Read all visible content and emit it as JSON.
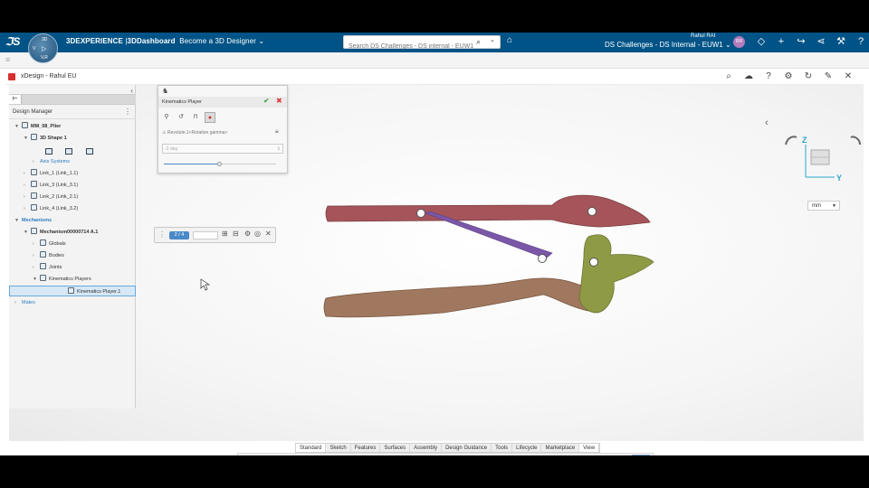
{
  "topbar": {
    "brand_prefix": "3DEXPERIENCE",
    "brand_sep": "|",
    "app": "3DDashboard",
    "dashboard": "Become a 3D Designer",
    "search_placeholder": "Search DS Challenges - DS internal - EUW1",
    "user_name": "Rahul  RAI",
    "tenant": "DS Challenges - DS Internal - EUW1",
    "avatar": "RR",
    "compass": {
      "n": "3D",
      "w": "V",
      "e": "▷",
      "s": "V,R"
    }
  },
  "app": {
    "title": "xDesign - Rahul EU"
  },
  "design_manager": {
    "title": "Design Manager",
    "tree": [
      {
        "label": "MM_08_Plier",
        "level": 0,
        "bold": true,
        "expanded": true
      },
      {
        "label": "3D Shape 1",
        "level": 1,
        "bold": true,
        "expanded": true
      },
      {
        "label": "Axis Systems",
        "level": 2,
        "blue": true,
        "expanded": false
      },
      {
        "label": "Link_1 (Link_1.1)",
        "level": 1,
        "expanded": false
      },
      {
        "label": "Link_3 (Link_3.1)",
        "level": 1,
        "expanded": false
      },
      {
        "label": "Link_2 (Link_2.1)",
        "level": 1,
        "expanded": false
      },
      {
        "label": "Link_4 (Link_3.2)",
        "level": 1,
        "expanded": false
      },
      {
        "label": "Mechanisms",
        "level": 0,
        "blue": true,
        "bold": true,
        "expanded": true
      },
      {
        "label": "Mechanism00000714 A.1",
        "level": 1,
        "bold": true,
        "expanded": true
      },
      {
        "label": "Globals",
        "level": 2,
        "expanded": false
      },
      {
        "label": "Bodies",
        "level": 2,
        "expanded": false
      },
      {
        "label": "Joints",
        "level": 2,
        "expanded": false
      },
      {
        "label": "Kinematics Players",
        "level": 2,
        "expanded": true
      },
      {
        "label": "Kinematics Player.1",
        "level": 3,
        "selected": true
      },
      {
        "label": "Mates",
        "level": 0,
        "blue": true,
        "expanded": false
      }
    ]
  },
  "kinematics_player": {
    "title": "Kinematics Player",
    "joint": "Revolute.1<Rotation gamma>",
    "value": "-3 deg",
    "slider_fraction": 0.5
  },
  "player_bar": {
    "counter": "2 / 4"
  },
  "viewcube": {
    "z": "Z",
    "y": "Y"
  },
  "units": "mm",
  "tabs": [
    "Standard",
    "Sketch",
    "Features",
    "Surfaces",
    "Assembly",
    "Design Guidance",
    "Tools",
    "Lifecycle",
    "Marketplace",
    "View"
  ],
  "active_tab": "View",
  "colors": {
    "topbar": "#005386",
    "link_red": "#a5555a",
    "link_brown": "#a07860",
    "link_purple": "#7b57a8",
    "link_olive": "#8f9a44"
  }
}
